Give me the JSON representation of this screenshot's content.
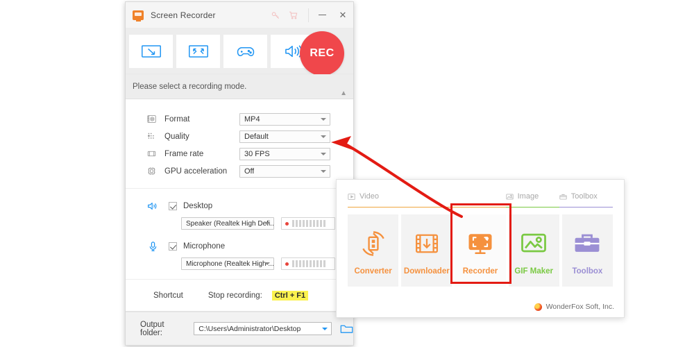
{
  "recorder_window": {
    "titlebar": {
      "app_icon": "screen-recorder-monitor-icon",
      "title": "Screen Recorder",
      "key_icon": "key-icon",
      "cart_icon": "shopping-cart-icon",
      "minimize_label": "–",
      "close_label": "✕"
    },
    "modes": [
      {
        "name": "custom-region",
        "icon": "rectangle-diagonal-arrow-icon"
      },
      {
        "name": "fullscreen",
        "icon": "rectangle-expand-corners-icon"
      },
      {
        "name": "game",
        "icon": "gamepad-icon"
      },
      {
        "name": "audio",
        "icon": "speaker-waves-icon"
      }
    ],
    "rec_button_label": "REC",
    "rec_button_color": "#f0474b",
    "hint_text": "Please select a recording mode.",
    "collapse_chevron": "▲",
    "settings": [
      {
        "icon": "film-gear-icon",
        "label": "Format",
        "value": "MP4"
      },
      {
        "icon": "quality-dots-icon",
        "label": "Quality",
        "value": "Default"
      },
      {
        "icon": "film-frame-icon",
        "label": "Frame rate",
        "value": "30 FPS"
      },
      {
        "icon": "chip-icon",
        "label": "GPU acceleration",
        "value": "Off"
      }
    ],
    "audio": [
      {
        "icon": "speaker-icon",
        "label": "Desktop",
        "checked": true,
        "device": "Speaker (Realtek High Defi..."
      },
      {
        "icon": "microphone-icon",
        "label": "Microphone",
        "checked": true,
        "device": "Microphone (Realtek High ..."
      }
    ],
    "shortcut": {
      "title": "Shortcut",
      "stop_label": "Stop recording:",
      "key": "Ctrl + F1",
      "key_highlight_color": "#fbf24f"
    },
    "output": {
      "label": "Output folder:",
      "path": "C:\\Users\\Administrator\\Desktop",
      "browse_icon": "folder-icon"
    }
  },
  "launcher_panel": {
    "categories": [
      {
        "id": "video",
        "icon": "video-play-icon",
        "label": "Video",
        "color": "#f0a53f"
      },
      {
        "id": "image",
        "icon": "image-icon",
        "label": "Image",
        "color": "#7ac943"
      },
      {
        "id": "toolbox",
        "icon": "toolbox-icon",
        "label": "Toolbox",
        "color": "#9b8fd4"
      }
    ],
    "tiles": [
      {
        "name": "converter",
        "icon": "converter-film-circle-icon",
        "label": "Converter",
        "color": "#f5913e",
        "selected": false
      },
      {
        "name": "downloader",
        "icon": "film-download-arrow-icon",
        "label": "Downloader",
        "color": "#f5913e",
        "selected": false
      },
      {
        "name": "recorder",
        "icon": "monitor-record-icon",
        "label": "Recorder",
        "color": "#f5913e",
        "selected": true
      },
      {
        "name": "gif-maker",
        "icon": "mountain-photo-icon",
        "label": "GIF Maker",
        "color": "#7ac943",
        "selected": false
      },
      {
        "name": "toolbox",
        "icon": "briefcase-icon",
        "label": "Toolbox",
        "color": "#9b8fd4",
        "selected": false
      }
    ],
    "selection_box_color": "#e31b13",
    "brand": {
      "logo": "wonderfox-logo-icon",
      "text": "WonderFox Soft, Inc."
    }
  },
  "annotation": {
    "arrow_color": "#e31b13",
    "description": "red-curved-arrow-from-recorder-tile-to-quality-dropdown"
  }
}
